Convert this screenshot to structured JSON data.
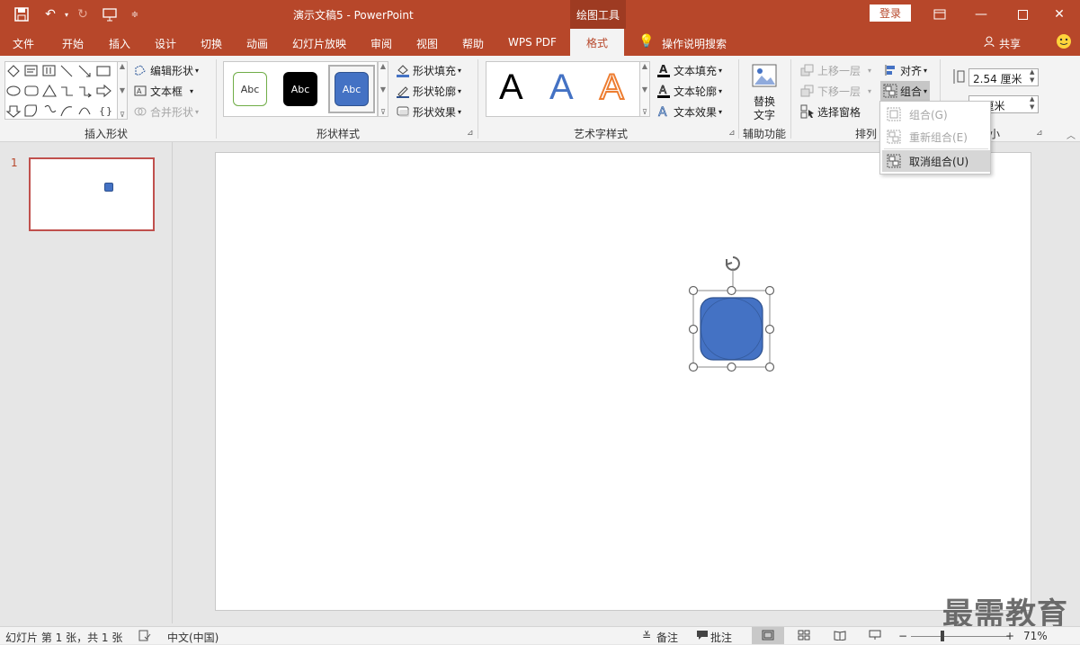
{
  "titlebar": {
    "doc_title": "演示文稿5  -  PowerPoint",
    "context_tab_title": "绘图工具",
    "login_label": "登录"
  },
  "menu": {
    "items": [
      "文件",
      "开始",
      "插入",
      "设计",
      "切换",
      "动画",
      "幻灯片放映",
      "审阅",
      "视图",
      "帮助",
      "WPS PDF"
    ],
    "active": "格式",
    "tell_me": "操作说明搜索",
    "share": "共享"
  },
  "ribbon": {
    "insert_shapes": {
      "label": "插入形状",
      "edit_shape": "编辑形状",
      "text_box": "文本框",
      "merge_shapes": "合并形状"
    },
    "shape_styles": {
      "label": "形状样式",
      "swatches": [
        "Abc",
        "Abc",
        "Abc"
      ],
      "fill": "形状填充",
      "outline": "形状轮廓",
      "effects": "形状效果"
    },
    "wordart_styles": {
      "label": "艺术字样式",
      "letters": [
        "A",
        "A",
        "A"
      ],
      "text_fill": "文本填充",
      "text_outline": "文本轮廓",
      "text_effects": "文本效果"
    },
    "accessibility": {
      "label": "辅助功能",
      "alt_text_line1": "替换",
      "alt_text_line2": "文字"
    },
    "arrange": {
      "label": "排列",
      "bring_forward": "上移一层",
      "send_backward": "下移一层",
      "selection_pane": "选择窗格",
      "align": "对齐",
      "group": "组合"
    },
    "size": {
      "label_partial": "小",
      "height": "2.54 厘米",
      "width_partial": "4 厘米"
    }
  },
  "group_menu": {
    "items": [
      {
        "label": "组合(G)",
        "enabled": false
      },
      {
        "label": "重新组合(E)",
        "enabled": false
      },
      {
        "label": "取消组合(U)",
        "enabled": true
      }
    ]
  },
  "slides_panel": {
    "slide_number": "1"
  },
  "statusbar": {
    "slide_info": "幻灯片 第 1 张，共 1 张",
    "language": "中文(中国)",
    "notes": "备注",
    "comments": "批注",
    "zoom": "71%"
  },
  "watermark": "最需教育",
  "colors": {
    "brand": "#b7472a",
    "shape_fill": "#4472c4"
  }
}
